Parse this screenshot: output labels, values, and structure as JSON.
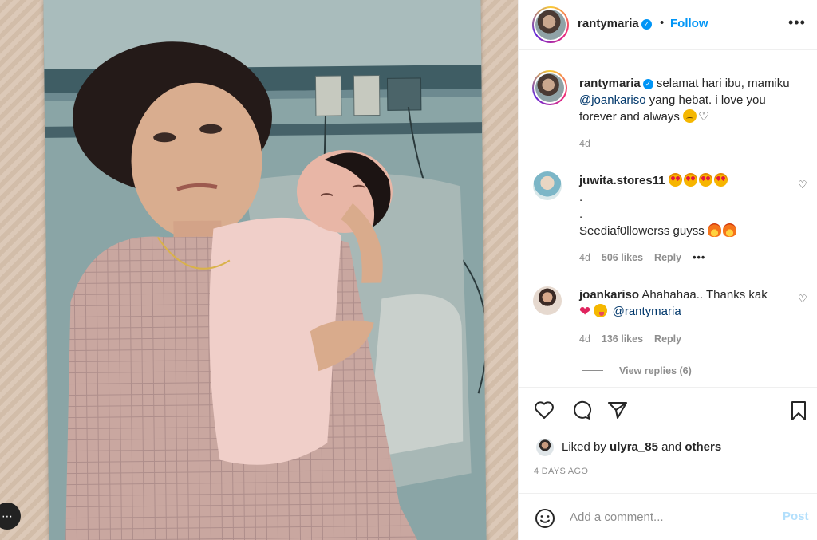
{
  "post": {
    "username": "rantymaria",
    "follow_label": "Follow",
    "separator": "•",
    "more_label": "•••",
    "caption": {
      "username": "rantymaria",
      "text_1": "selamat hari ibu, mamiku",
      "mention": "@joankariso",
      "text_2": "yang hebat. i love you forever and always",
      "age": "4d"
    }
  },
  "comments": [
    {
      "username": "juwita.stores11",
      "dot_1": ".",
      "dot_2": ".",
      "text": "Seediaf0llowerss guyss",
      "age": "4d",
      "likes": "506 likes",
      "reply_label": "Reply",
      "more_label": "•••"
    },
    {
      "username": "joankariso",
      "text": "Ahahahaa.. Thanks kak",
      "mention": "@rantymaria",
      "age": "4d",
      "likes": "136 likes",
      "reply_label": "Reply"
    }
  ],
  "view_replies": "View replies (6)",
  "likes": {
    "prefix": "Liked by",
    "user": "ulyra_85",
    "mid": "and",
    "others": "others"
  },
  "time_ago": "4 DAYS AGO",
  "comment_box": {
    "placeholder": "Add a comment...",
    "post_label": "Post"
  },
  "colors": {
    "link_blue": "#0095f6",
    "muted": "#8e8e8e",
    "text": "#262626"
  }
}
